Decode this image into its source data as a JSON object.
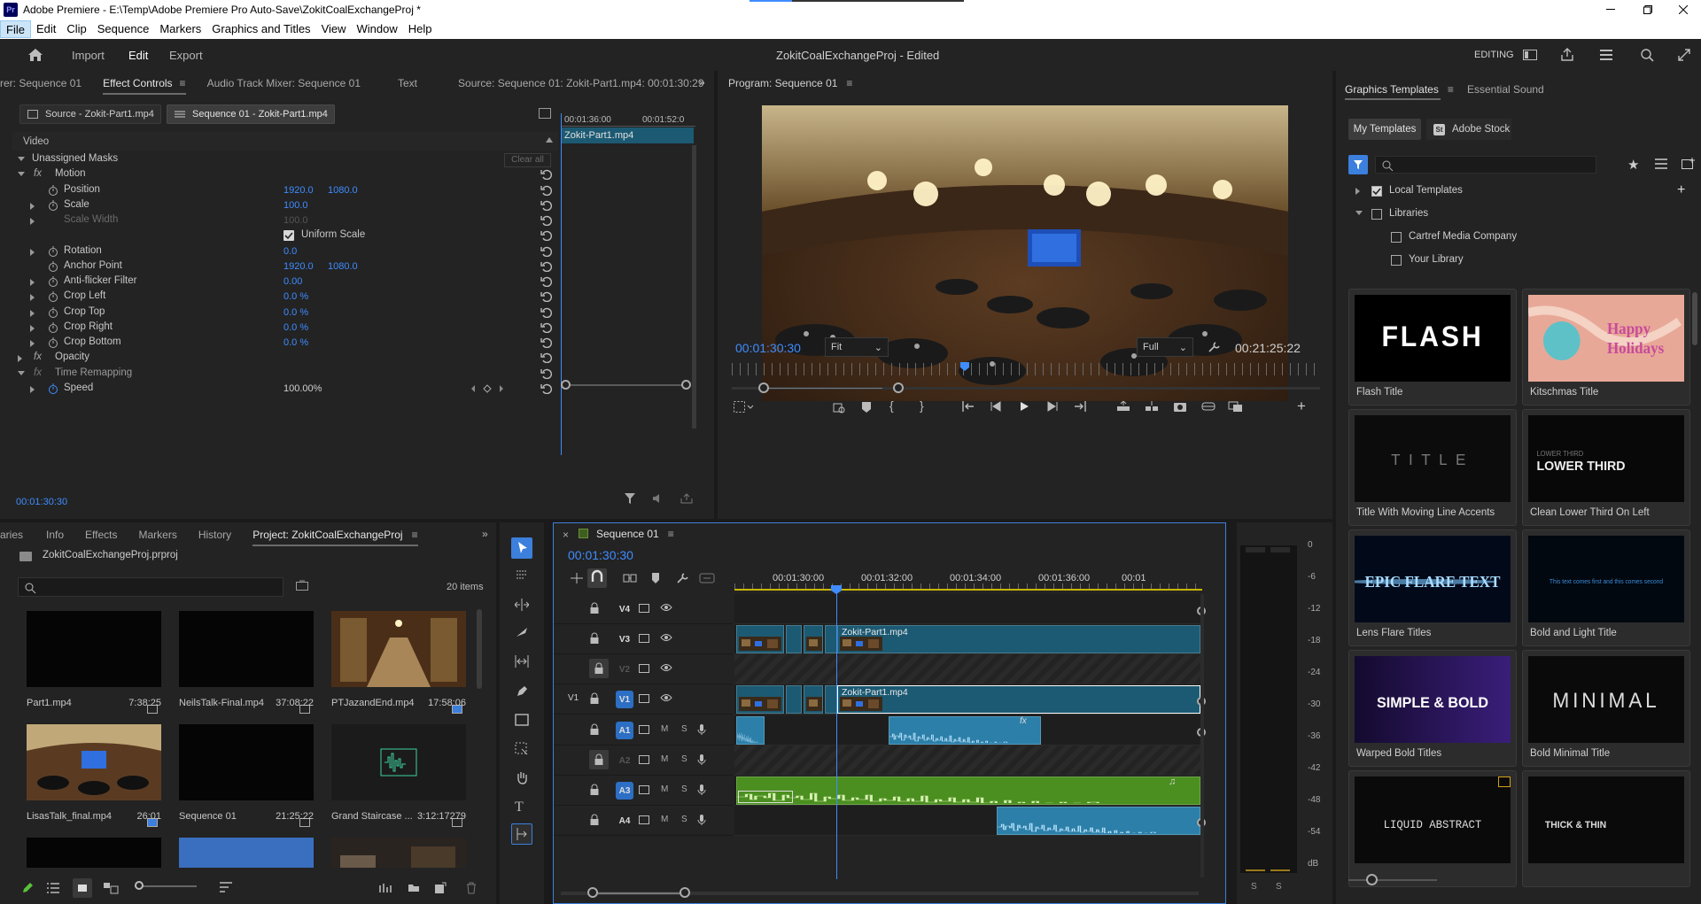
{
  "app": {
    "title": "Adobe Premiere - E:\\Temp\\Adobe Premiere Pro Auto-Save\\ZokitCoalExchangeProj *",
    "logo": "Pr"
  },
  "menu": [
    "File",
    "Edit",
    "Clip",
    "Sequence",
    "Markers",
    "Graphics and Titles",
    "View",
    "Window",
    "Help"
  ],
  "header": {
    "tabs": [
      "Import",
      "Edit",
      "Export"
    ],
    "active_tab": "Edit",
    "project_title": "ZokitCoalExchangeProj",
    "project_status": "- Edited",
    "workspace_label": "EDITING"
  },
  "source_panel": {
    "tabs": [
      "rer: Sequence 01",
      "Effect Controls",
      "Audio Track Mixer: Sequence 01",
      "Text",
      "Source: Sequence 01: Zokit-Part1.mp4: 00:01:30:29"
    ],
    "active_tab": "Effect Controls",
    "clip_source": "Source - Zokit-Part1.mp4",
    "clip_sequence": "Sequence 01 - Zokit-Part1.mp4",
    "video_label": "Video",
    "clear_all": "Clear all",
    "mini_ruler": [
      "00:01:36:00",
      "00:01:52:0"
    ],
    "mini_clip": "Zokit-Part1.mp4",
    "timecode": "00:01:30:30",
    "rows": [
      {
        "label": "Unassigned Masks",
        "expand": "down",
        "fx": false
      },
      {
        "label": "Motion",
        "expand": "down",
        "fx": true
      },
      {
        "label": "Position",
        "v1": "1920.0",
        "v2": "1080.0",
        "stopwatch": true
      },
      {
        "label": "Scale",
        "v1": "100.0",
        "expand": "right",
        "stopwatch": true
      },
      {
        "label": "Scale Width",
        "v1": "100.0",
        "expand": "right",
        "disabled": true
      },
      {
        "label": "Uniform Scale",
        "checkbox": true
      },
      {
        "label": "Rotation",
        "v1": "0.0",
        "expand": "right",
        "stopwatch": true
      },
      {
        "label": "Anchor Point",
        "v1": "1920.0",
        "v2": "1080.0",
        "stopwatch": true
      },
      {
        "label": "Anti-flicker Filter",
        "v1": "0.00",
        "expand": "right",
        "stopwatch": true
      },
      {
        "label": "Crop Left",
        "v1": "0.0 %",
        "expand": "right",
        "stopwatch": true
      },
      {
        "label": "Crop Top",
        "v1": "0.0 %",
        "expand": "right",
        "stopwatch": true
      },
      {
        "label": "Crop Right",
        "v1": "0.0 %",
        "expand": "right",
        "stopwatch": true
      },
      {
        "label": "Crop Bottom",
        "v1": "0.0 %",
        "expand": "right",
        "stopwatch": true
      },
      {
        "label": "Opacity",
        "expand": "right",
        "fx": true
      },
      {
        "label": "Time Remapping",
        "expand": "down",
        "fx": true,
        "dim": true
      },
      {
        "label": "Speed",
        "v1": "100.00%",
        "expand": "right",
        "stopwatch": true,
        "plain": true
      }
    ]
  },
  "program_monitor": {
    "title": "Program: Sequence 01",
    "timecode": "00:01:30:30",
    "fit": "Fit",
    "quality": "Full",
    "duration": "00:21:25:22"
  },
  "project_panel": {
    "tabs": [
      "aries",
      "Info",
      "Effects",
      "Markers",
      "History",
      "Project: ZokitCoalExchangeProj"
    ],
    "active_tab": "Project: ZokitCoalExchangeProj",
    "file": "ZokitCoalExchangeProj.prproj",
    "search_placeholder": "",
    "item_count": "20 items",
    "items": [
      {
        "name": "Part1.mp4",
        "duration": "7:38:25",
        "kind": "black"
      },
      {
        "name": "NeilsTalk-Final.mp4",
        "duration": "37:08:22",
        "kind": "black"
      },
      {
        "name": "PTJazandEnd.mp4",
        "duration": "17:58:06",
        "kind": "hall"
      },
      {
        "name": "LisasTalk_final.mp4",
        "duration": "26:01",
        "kind": "room"
      },
      {
        "name": "Sequence 01",
        "duration": "21:25:22",
        "kind": "black"
      },
      {
        "name": "Grand Staircase ...",
        "duration": "3:12:17279",
        "kind": "audio"
      },
      {
        "name": "",
        "duration": "",
        "kind": "black"
      },
      {
        "name": "",
        "duration": "",
        "kind": "sky"
      },
      {
        "name": "",
        "duration": "",
        "kind": "hall2"
      }
    ]
  },
  "timeline": {
    "title": "Sequence 01",
    "timecode": "00:01:30:30",
    "ruler": [
      "00:01:30:00",
      "00:01:32:00",
      "00:01:34:00",
      "00:01:36:00",
      "00:01"
    ],
    "tracks": [
      {
        "id": "V4",
        "type": "video"
      },
      {
        "id": "V3",
        "type": "video"
      },
      {
        "id": "V2",
        "type": "video",
        "locked": true
      },
      {
        "id": "V1",
        "type": "video",
        "source": "V1"
      },
      {
        "id": "A1",
        "type": "audio"
      },
      {
        "id": "A2",
        "type": "audio",
        "locked": true
      },
      {
        "id": "A3",
        "type": "audio"
      },
      {
        "id": "A4",
        "type": "audio"
      }
    ],
    "clip_v3": "Zokit-Part1.mp4",
    "clip_v1": "Zokit-Part1.mp4",
    "fx": "fx"
  },
  "meter": {
    "scale": [
      "0",
      "-6",
      "-12",
      "-18",
      "-24",
      "-30",
      "-36",
      "-42",
      "-48",
      "-54",
      "dB"
    ],
    "solo": [
      "S",
      "S"
    ]
  },
  "graphics_panel": {
    "tabs": [
      "Graphics Templates",
      "Essential Sound"
    ],
    "active_tab": "Graphics Templates",
    "subtabs": [
      "My Templates",
      "Adobe Stock"
    ],
    "tree": [
      {
        "label": "Local Templates",
        "checked": true,
        "expand": "right"
      },
      {
        "label": "Libraries",
        "checked": false,
        "expand": "down"
      },
      {
        "label": "Cartref Media Company",
        "checked": false,
        "child": true
      },
      {
        "label": "Your Library",
        "checked": false,
        "child": true
      }
    ],
    "templates": [
      {
        "name": "Flash Title",
        "art": "FLASH"
      },
      {
        "name": "Kitschmas Title",
        "art": "Happy Holidays"
      },
      {
        "name": "Title With Moving Line Accents",
        "art": "TITLE"
      },
      {
        "name": "Clean Lower Third On Left",
        "art": "LOWER THIRD"
      },
      {
        "name": "Lens Flare Titles",
        "art": "EPIC FLARE TEXT"
      },
      {
        "name": "Bold and Light Title",
        "art": "This text comes first and this comes second"
      },
      {
        "name": "Warped Bold Titles",
        "art": "SIMPLE & BOLD"
      },
      {
        "name": "Bold Minimal Title",
        "art": "MINIMAL"
      },
      {
        "name": "",
        "art": "LIQUID ABSTRACT"
      },
      {
        "name": "",
        "art": "THICK & THIN"
      }
    ]
  },
  "colors": {
    "accent": "#3f8cff",
    "video_clip": "#1c5a73",
    "audio_clip": "#2b7fa8",
    "audio_green": "#4a8f1f",
    "panel": "#232323"
  }
}
